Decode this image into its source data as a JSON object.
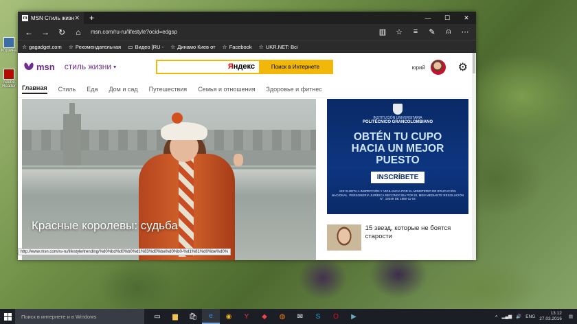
{
  "desktop": {
    "icons": [
      {
        "label": "Корзина"
      },
      {
        "label": "Adobe Reader"
      }
    ]
  },
  "browser": {
    "tab_title": "MSN Стиль жизни",
    "url": "msn.com/ru-ru/lifestyle?ocid=edgsp",
    "favorites": [
      {
        "label": "gagadget.com"
      },
      {
        "label": "Рекомендательная"
      },
      {
        "label": "Видео [RU -"
      },
      {
        "label": "Динамо Киев от"
      },
      {
        "label": "Facebook"
      },
      {
        "label": "UKR.NET: Всі"
      }
    ],
    "status_url": "http://www.msn.com/ru-ru/lifestyle/trending/%d0%bd%d0%b0%d1%83%d0%ba%d0%b0-%d1%81%d0%be%d0%"
  },
  "msn": {
    "logo": "msn",
    "section": "стиль жизни",
    "search_brand_red": "Я",
    "search_brand_black": "ндекс",
    "search_button": "Поиск в Интернете",
    "user_name": "юрий",
    "nav": [
      "Главная",
      "Стиль",
      "Еда",
      "Дом и сад",
      "Путешествия",
      "Семья и отношения",
      "Здоровье и фитнес"
    ],
    "hero_caption": "Красные королевы: судьба",
    "ad": {
      "inst_small": "INSTITUCIÓN UNIVERSITARIA",
      "inst_name": "POLITÉCNICO GRANCOLOMBIANO",
      "headline_1": "OBTÉN TU CUPO",
      "headline_2": "HACIA UN MEJOR",
      "headline_3": "PUESTO",
      "cta": "INSCRÍBETE",
      "legal": "IES SUJETA A INSPECCIÓN Y VIGILANCIA POR EL MINISTERIO DE EDUCACIÓN NACIONAL. PERSONERÍA JURÍDICA RECONOCIDA POR EL MEN MEDIANTE RESOLUCIÓN N°. 19349 DE 1980-11-04"
    },
    "story_title": "15 звезд, которые не боятся старости"
  },
  "taskbar": {
    "search_placeholder": "Поиск в интернете и в Windows",
    "lang": "ENG",
    "time": "13:12",
    "date": "27.03.2016"
  }
}
